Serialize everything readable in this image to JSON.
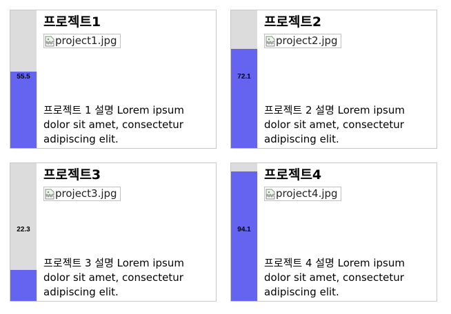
{
  "colors": {
    "gauge_track": "#dcdcdc",
    "gauge_fill": "#6464f0",
    "card_border": "#c8c8c8"
  },
  "projects": [
    {
      "title": "프로젝트1",
      "image_alt": "project1.jpg",
      "gauge_value": "55.5",
      "gauge_fraction": 0.555,
      "description": "프로젝트 1 설명 Lorem ipsum dolor sit amet, consectetur adipiscing elit."
    },
    {
      "title": "프로젝트2",
      "image_alt": "project2.jpg",
      "gauge_value": "72.1",
      "gauge_fraction": 0.721,
      "description": "프로젝트 2 설명 Lorem ipsum dolor sit amet, consectetur adipiscing elit."
    },
    {
      "title": "프로젝트3",
      "image_alt": "project3.jpg",
      "gauge_value": "22.3",
      "gauge_fraction": 0.223,
      "description": "프로젝트 3 설명 Lorem ipsum dolor sit amet, consectetur adipiscing elit."
    },
    {
      "title": "프로젝트4",
      "image_alt": "project4.jpg",
      "gauge_value": "94.1",
      "gauge_fraction": 0.941,
      "description": "프로젝트 4 설명 Lorem ipsum dolor sit amet, consectetur adipiscing elit."
    }
  ]
}
